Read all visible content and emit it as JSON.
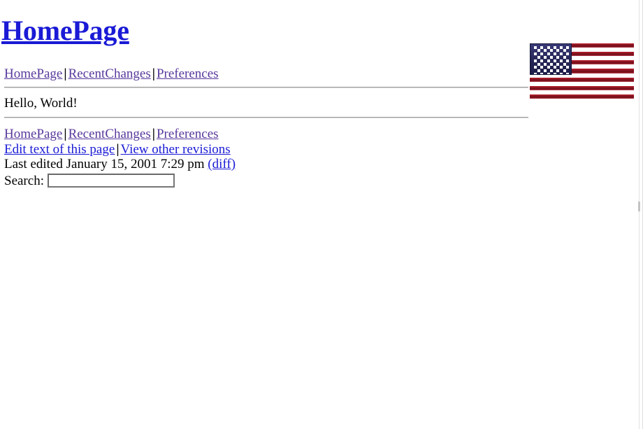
{
  "page": {
    "title": "HomePage",
    "background_color": "#ffffff",
    "link_color": "#1a1ad6",
    "visited_link_color": "#58389c",
    "text_color": "#000000"
  },
  "header": {
    "title_link_label": "HomePage"
  },
  "top_nav": {
    "separator": "|",
    "items": [
      {
        "label": "HomePage",
        "state": "visited"
      },
      {
        "label": "RecentChanges",
        "state": "visited"
      },
      {
        "label": "Preferences",
        "state": "visited"
      }
    ]
  },
  "main": {
    "body_text": "Hello, World!"
  },
  "footer": {
    "separator": "|",
    "nav_items": [
      {
        "label": "HomePage",
        "state": "visited"
      },
      {
        "label": "RecentChanges",
        "state": "visited"
      },
      {
        "label": "Preferences",
        "state": "visited"
      }
    ],
    "action_items": [
      {
        "label": "Edit text of this page",
        "state": "fresh"
      },
      {
        "label": "View other revisions",
        "state": "fresh"
      }
    ],
    "last_edited_prefix": "Last edited",
    "last_edited_timestamp": "January 15, 2001 7:29 pm",
    "diff_link_label": "(diff)",
    "search_label": "Search:",
    "search_value": "",
    "search_placeholder": ""
  },
  "flag_image": {
    "name": "us-flag-image",
    "alt": "United States flag",
    "stripe_count": 13,
    "star_rows": 9,
    "stripe_red": "#8f1523",
    "stripe_white": "#ffffff",
    "canton_blue": "#262657",
    "star_color": "#ffffff"
  }
}
